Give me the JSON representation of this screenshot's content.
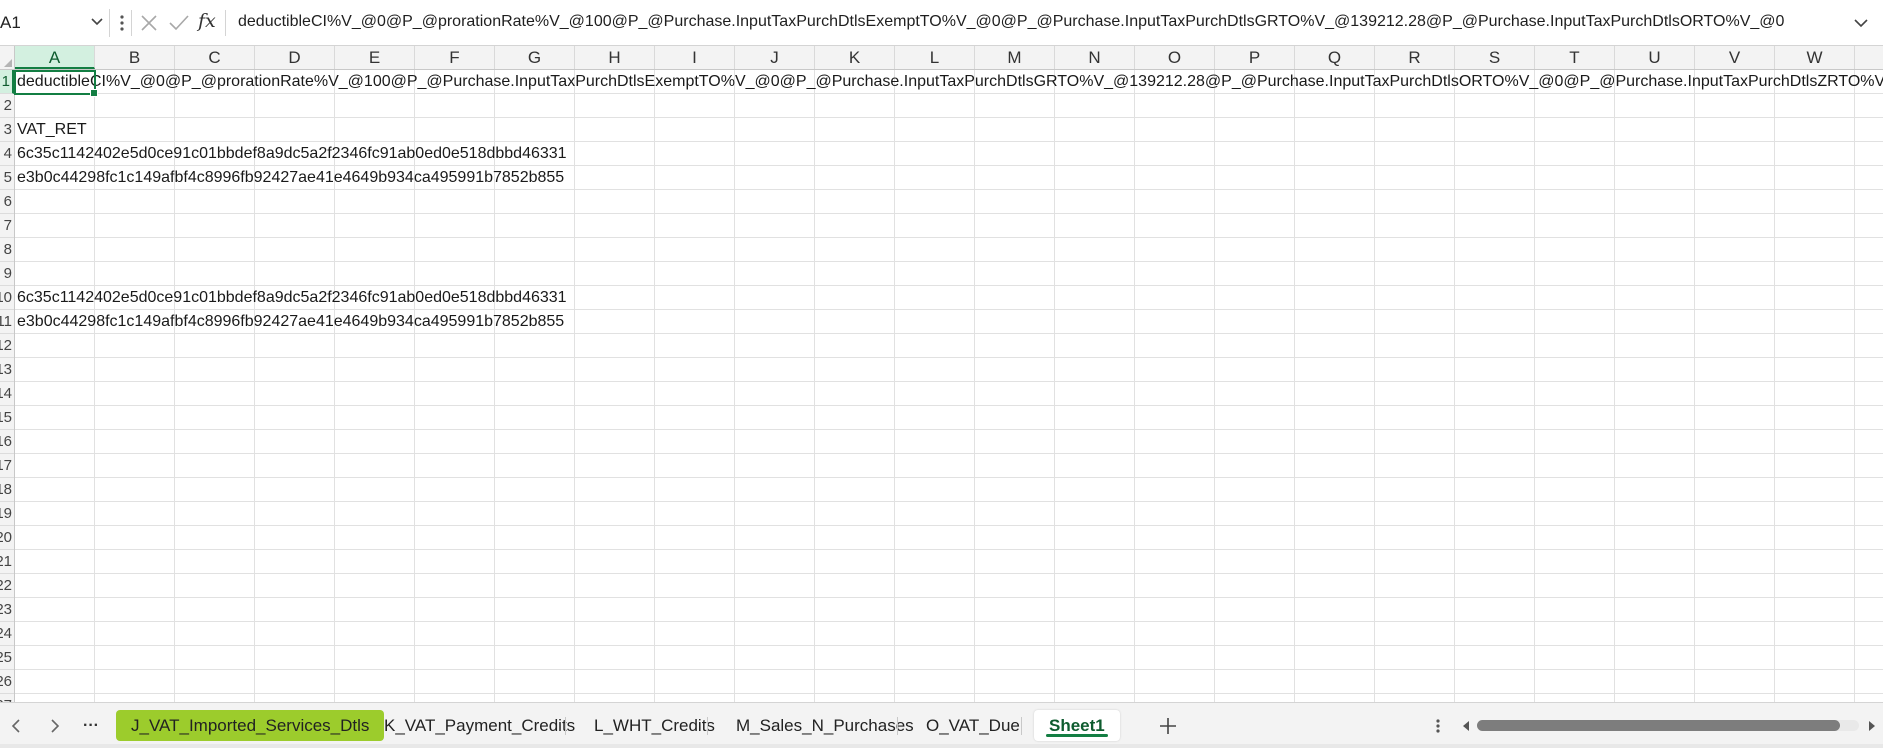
{
  "formula_bar": {
    "name_box": "A1",
    "fx_label": "fx",
    "formula": "deductibleCI%V_@0@P_@prorationRate%V_@100@P_@Purchase.InputTaxPurchDtlsExemptTO%V_@0@P_@Purchase.InputTaxPurchDtlsGRTO%V_@139212.28@P_@Purchase.InputTaxPurchDtlsORTO%V_@0"
  },
  "grid": {
    "selected_cell": "A1",
    "columns": [
      "A",
      "B",
      "C",
      "D",
      "E",
      "F",
      "G",
      "H",
      "I",
      "J",
      "K",
      "L",
      "M",
      "N",
      "O",
      "P",
      "Q",
      "R",
      "S",
      "T",
      "U",
      "V",
      "W"
    ],
    "rows": [
      "1",
      "2",
      "3",
      "4",
      "5",
      "6",
      "7",
      "8",
      "9",
      "10",
      "11",
      "12",
      "13",
      "14",
      "15",
      "16",
      "17",
      "18",
      "19",
      "20",
      "21",
      "22",
      "23",
      "24",
      "25",
      "26",
      "27"
    ],
    "cells": {
      "A1": "deductibleCI%V_@0@P_@prorationRate%V_@100@P_@Purchase.InputTaxPurchDtlsExemptTO%V_@0@P_@Purchase.InputTaxPurchDtlsGRTO%V_@139212.28@P_@Purchase.InputTaxPurchDtlsORTO%V_@0@P_@Purchase.InputTaxPurchDtlsZRTO%V_",
      "A3": "VAT_RET",
      "A4": "6c35c1142402e5d0ce91c01bbdef8a9dc5a2f2346fc91ab0ed0e518dbbd46331",
      "A5": "e3b0c44298fc1c149afbf4c8996fb92427ae41e4649b934ca495991b7852b855",
      "A10": "6c35c1142402e5d0ce91c01bbdef8a9dc5a2f2346fc91ab0ed0e518dbbd46331",
      "A11": "e3b0c44298fc1c149afbf4c8996fb92427ae41e4649b934ca495991b7852b855"
    }
  },
  "sheet_tabs": {
    "more_label": "···",
    "tabs": [
      {
        "label": "J_VAT_Imported_Services_Dtls",
        "tab_color": "#9ccc2c"
      },
      {
        "label": "K_VAT_Payment_Credits"
      },
      {
        "label": "L_WHT_Credits"
      },
      {
        "label": "M_Sales_N_Purchases"
      },
      {
        "label": "O_VAT_Due"
      },
      {
        "label": "Sheet1",
        "active": true
      }
    ],
    "scroll_position": 0.95
  },
  "theme": {
    "accent": "#137e43",
    "header_bg": "#f3f3f3"
  }
}
